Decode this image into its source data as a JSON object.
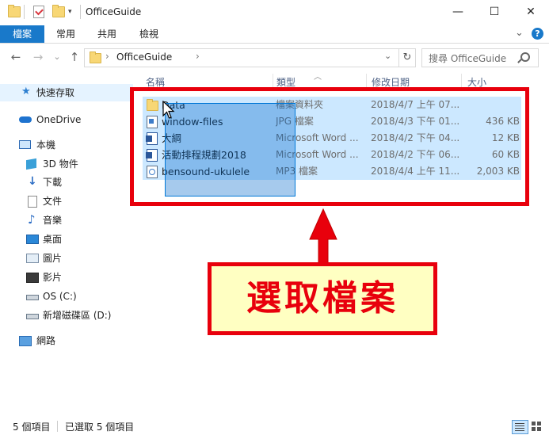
{
  "window": {
    "title": "OfficeGuide",
    "minimize_glyph": "—",
    "maximize_glyph": "☐",
    "close_glyph": "✕"
  },
  "ribbon": {
    "tabs": [
      "檔案",
      "常用",
      "共用",
      "檢視"
    ],
    "collapse_glyph": "⌄",
    "help_glyph": "?"
  },
  "address": {
    "back_glyph": "←",
    "forward_glyph": "→",
    "recent_glyph": "⌄",
    "up_glyph": "↑",
    "separator_glyph": "›",
    "path": "OfficeGuide",
    "refresh_glyph": "↻",
    "search_placeholder": "搜尋 OfficeGuide"
  },
  "nav": {
    "quick_access": "快速存取",
    "onedrive": "OneDrive",
    "this_pc": "本機",
    "items": [
      "3D 物件",
      "下載",
      "文件",
      "音樂",
      "桌面",
      "圖片",
      "影片",
      "OS (C:)",
      "新增磁碟區 (D:)"
    ],
    "network": "網路"
  },
  "columns": {
    "name": "名稱",
    "type": "類型",
    "date": "修改日期",
    "size": "大小"
  },
  "files": [
    {
      "name": "Data",
      "type": "檔案資料夾",
      "date": "2018/4/7 上午 07...",
      "size": "",
      "icon": "folder-icon"
    },
    {
      "name": "window-files",
      "type": "JPG 檔案",
      "date": "2018/4/3 下午 01...",
      "size": "436 KB",
      "icon": "image-file-icon"
    },
    {
      "name": "大綱",
      "type": "Microsoft Word ...",
      "date": "2018/4/2 下午 04...",
      "size": "12 KB",
      "icon": "word-file-icon"
    },
    {
      "name": "活動排程規劃2018",
      "type": "Microsoft Word ...",
      "date": "2018/4/2 下午 06...",
      "size": "60 KB",
      "icon": "word-file-icon"
    },
    {
      "name": "bensound-ukulele",
      "type": "MP3 檔案",
      "date": "2018/4/4 上午 11...",
      "size": "2,003 KB",
      "icon": "audio-file-icon"
    }
  ],
  "status": {
    "count": "5 個項目",
    "selected": "已選取 5 個項目"
  },
  "callout": {
    "text": "選取檔案"
  },
  "colors": {
    "accent": "#1979ca",
    "selection": "#cce8ff",
    "annotation_red": "#e8000c",
    "callout_fill": "#ffffc2"
  }
}
